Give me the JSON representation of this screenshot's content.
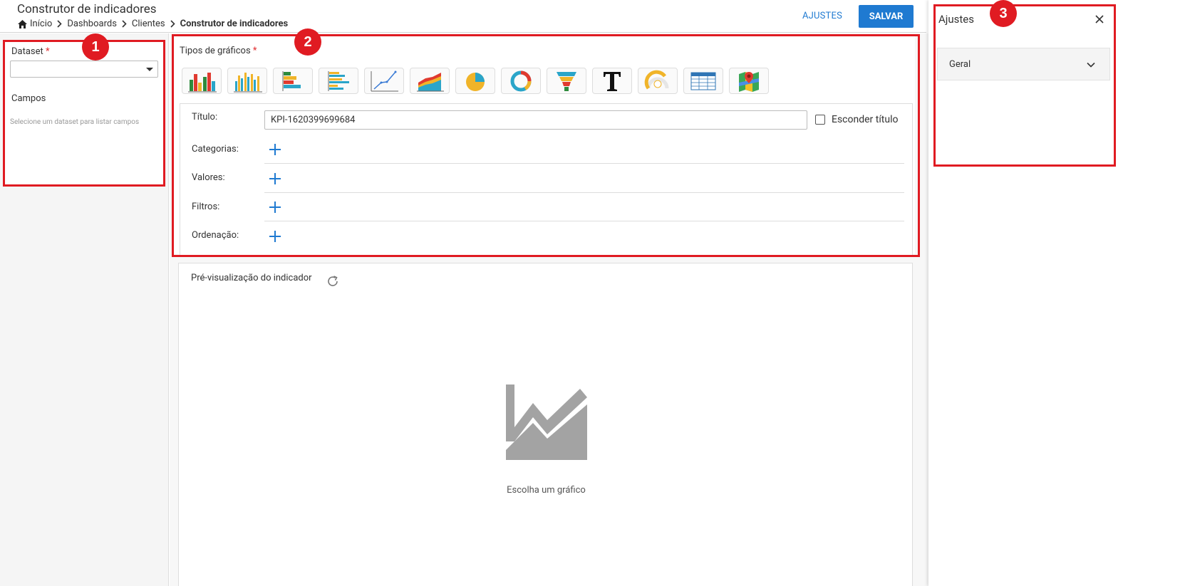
{
  "header": {
    "title": "Construtor de indicadores",
    "breadcrumb": [
      "Início",
      "Dashboards",
      "Clientes",
      "Construtor de indicadores"
    ],
    "ajustes_label": "AJUSTES",
    "salvar_label": "SALVAR"
  },
  "left_panel": {
    "dataset_label": "Dataset",
    "required_marker": "*",
    "dataset_value": "",
    "campos_label": "Campos",
    "campos_hint": "Selecione um dataset para listar campos"
  },
  "chart_types": {
    "label": "Tipos de gráficos",
    "required_marker": "*",
    "icons": [
      "bar-chart-icon",
      "stacked-bar-chart-icon",
      "horizontal-bar-chart-icon",
      "stacked-horizontal-bar-chart-icon",
      "line-chart-icon",
      "area-chart-icon",
      "pie-chart-icon",
      "donut-chart-icon",
      "funnel-chart-icon",
      "text-icon",
      "gauge-chart-icon",
      "table-icon",
      "map-icon"
    ]
  },
  "form": {
    "title_label": "Título:",
    "title_value": "KPI-1620399699684",
    "hide_title_label": "Esconder título",
    "categories_label": "Categorias:",
    "values_label": "Valores:",
    "filters_label": "Filtros:",
    "order_label": "Ordenação:"
  },
  "preview": {
    "label": "Pré-visualização do indicador",
    "placeholder": "Escolha um gráfico"
  },
  "right_panel": {
    "title": "Ajustes",
    "accordion_label": "Geral"
  },
  "annotations": [
    "1",
    "2",
    "3"
  ],
  "colors": {
    "accent": "#1f7ad1",
    "annotation": "#e01b22"
  }
}
